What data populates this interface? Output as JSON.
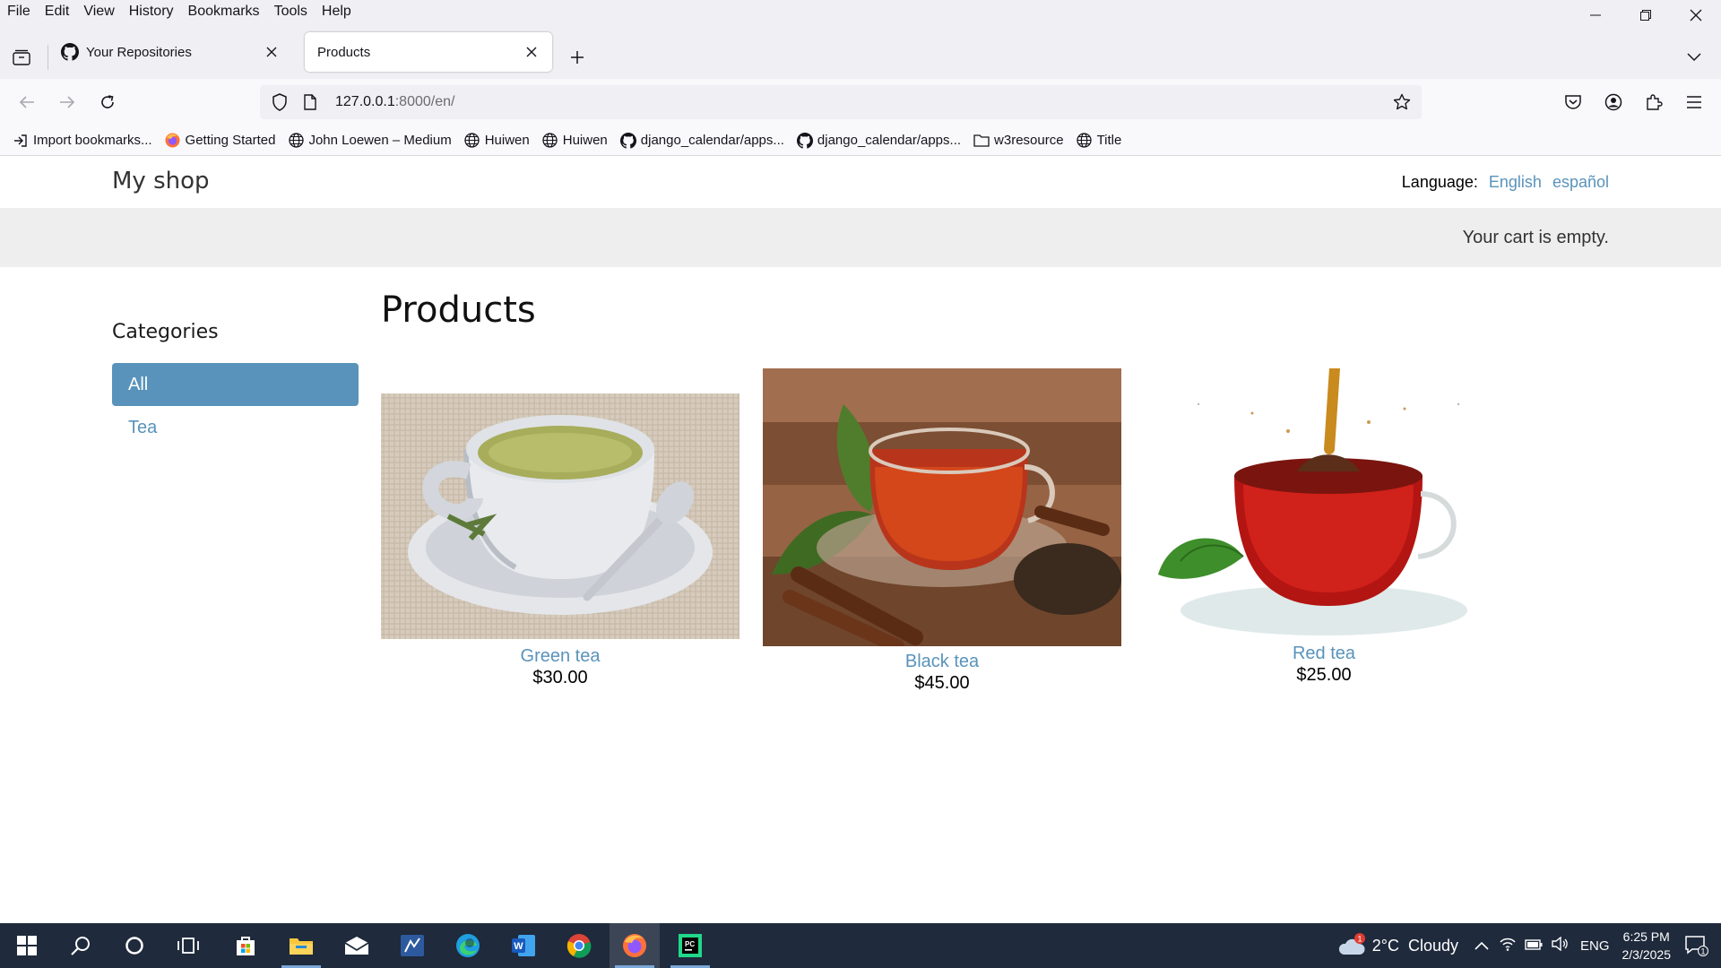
{
  "browser": {
    "menu": [
      "File",
      "Edit",
      "View",
      "History",
      "Bookmarks",
      "Tools",
      "Help"
    ],
    "tabs": [
      {
        "title": "Your Repositories",
        "icon": "github-icon",
        "active": false
      },
      {
        "title": "Products",
        "icon": "",
        "active": true
      }
    ],
    "url_host": "127.0.0.1",
    "url_rest": ":8000/en/",
    "bookmarks": [
      {
        "label": "Import bookmarks...",
        "icon": "import-icon"
      },
      {
        "label": "Getting Started",
        "icon": "firefox-icon"
      },
      {
        "label": "John Loewen – Medium",
        "icon": "globe-icon"
      },
      {
        "label": "Huiwen",
        "icon": "globe-icon"
      },
      {
        "label": "Huiwen",
        "icon": "globe-icon"
      },
      {
        "label": "django_calendar/apps...",
        "icon": "github-icon"
      },
      {
        "label": "django_calendar/apps...",
        "icon": "github-icon"
      },
      {
        "label": "w3resource",
        "icon": "folder-icon"
      },
      {
        "label": "Title",
        "icon": "globe-icon"
      }
    ]
  },
  "site": {
    "logo": "My shop",
    "language_label": "Language:",
    "languages": [
      "English",
      "español"
    ],
    "cart": "Your cart is empty.",
    "categories_title": "Categories",
    "categories": [
      "All",
      "Tea"
    ],
    "selected_category": "All",
    "heading": "Products",
    "products": [
      {
        "name": "Green tea",
        "price": "$30.00"
      },
      {
        "name": "Black tea",
        "price": "$45.00"
      },
      {
        "name": "Red tea",
        "price": "$25.00"
      }
    ]
  },
  "taskbar": {
    "weather": "2°C  Cloudy",
    "weather_badge": "1",
    "language": "ENG",
    "time": "6:25 PM",
    "date": "2/3/2025",
    "notification_count": "1"
  },
  "colors": {
    "link": "#5993bb",
    "taskbar": "#1f2a3c"
  }
}
